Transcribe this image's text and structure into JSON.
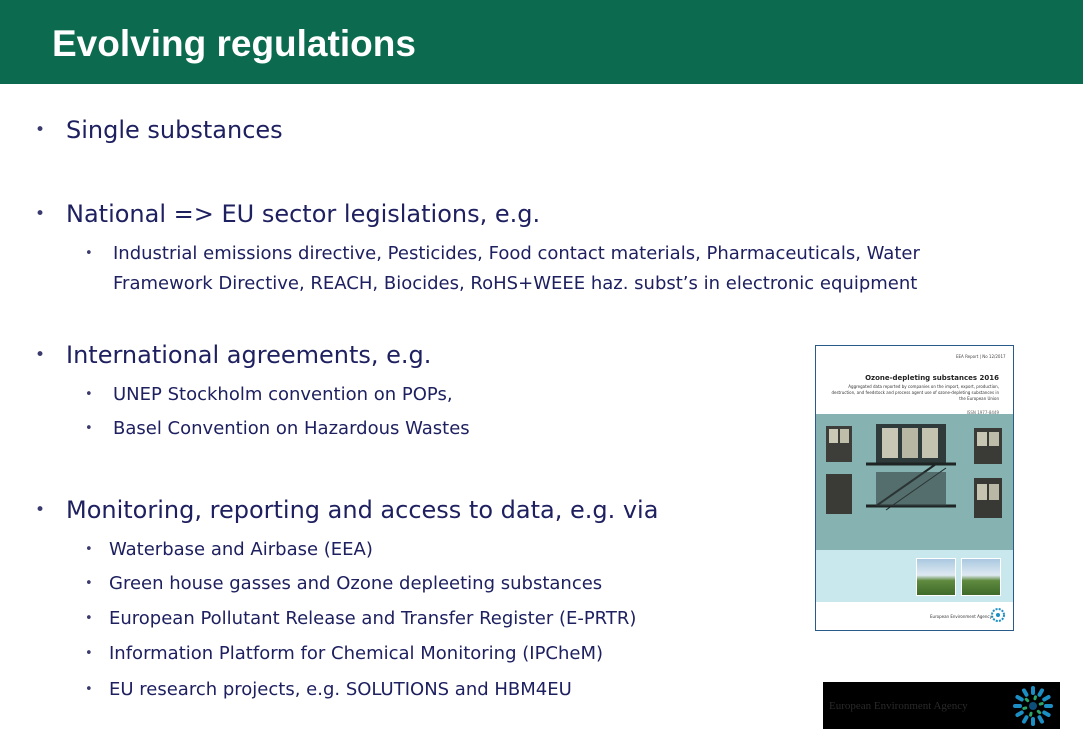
{
  "slide": {
    "title": "Evolving regulations",
    "bullets": [
      {
        "text": "Single substances",
        "sub": []
      },
      {
        "text": "National => EU sector legislations, e.g.",
        "sub": [
          "Industrial emissions directive, Pesticides, Food contact materials, Pharmaceuticals, Water Framework Directive, REACH, Biocides, RoHS+WEEE haz. subst’s in electronic equipment"
        ]
      },
      {
        "text": "International agreements, e.g.",
        "sub": [
          "UNEP Stockholm convention on POPs,",
          "Basel Convention on Hazardous Wastes"
        ]
      },
      {
        "text": "Monitoring, reporting and access to data, e.g. via",
        "sub": [
          "Waterbase and Airbase (EEA)",
          "Green house gasses and Ozone depleeting substances",
          "European Pollutant Release and Transfer Register (E-PRTR)",
          "Information Platform for Chemical Monitoring (IPCheM)",
          "EU research projects, e.g. SOLUTIONS and HBM4EU"
        ]
      }
    ],
    "sub_line2": {
      "line1": "Industrial emissions directive, Pesticides, Food contact materials, Pharmaceuticals, Water",
      "line2": "Framework Directive, REACH, Biocides, RoHS+WEEE haz. subst’s in electronic equipment"
    }
  },
  "report_cover": {
    "top_line": "EEA Report | No 12/2017",
    "title": "Ozone-depleting substances 2016",
    "subtitle": "Aggregated data reported by companies on the import, export, production, destruction, and feedstock and process agent use of ozone-depleting substances in the European Union",
    "isbn": "ISSN 1977-8449",
    "footer": "European Environment Agency"
  },
  "logo": {
    "text": "European Environment Agency"
  },
  "colors": {
    "header_bg": "#0c6b4e",
    "title": "#ffffff",
    "body_text": "#1e2060",
    "logo_accent": "#1b8fc4"
  }
}
